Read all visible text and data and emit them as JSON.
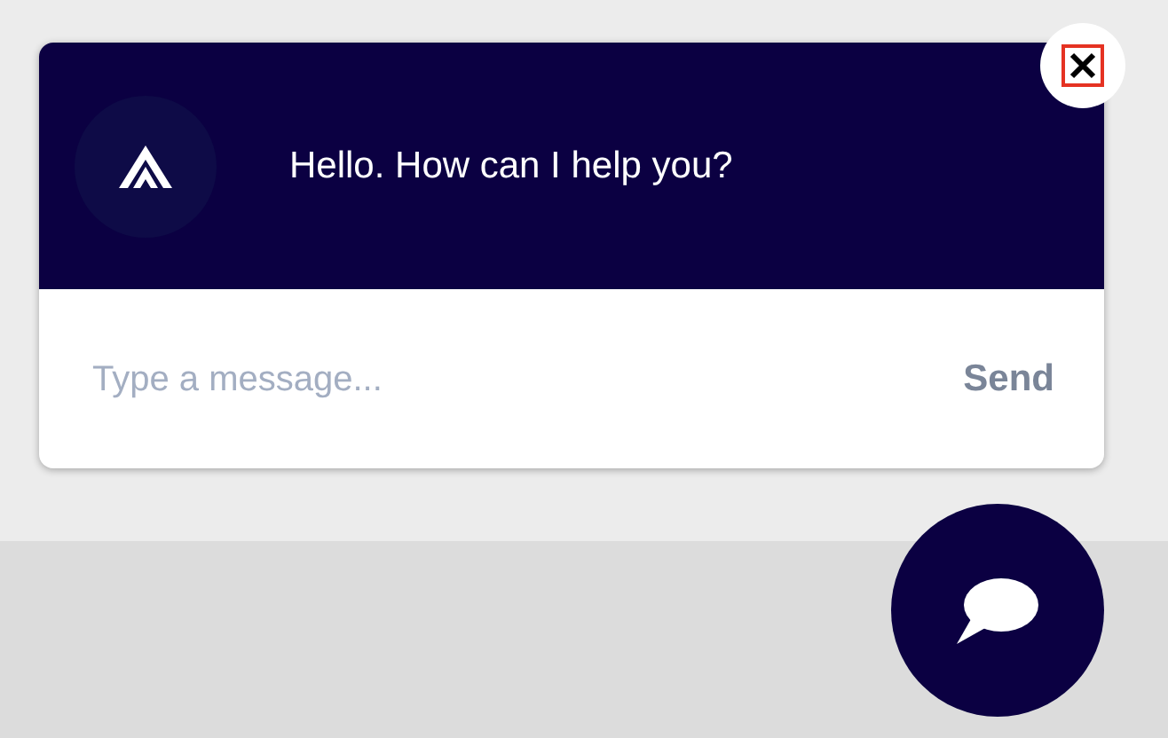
{
  "chat_panel": {
    "greeting": "Hello. How can I help you?",
    "message_field": {
      "placeholder": "Type a message..."
    },
    "send_button": "Send"
  }
}
